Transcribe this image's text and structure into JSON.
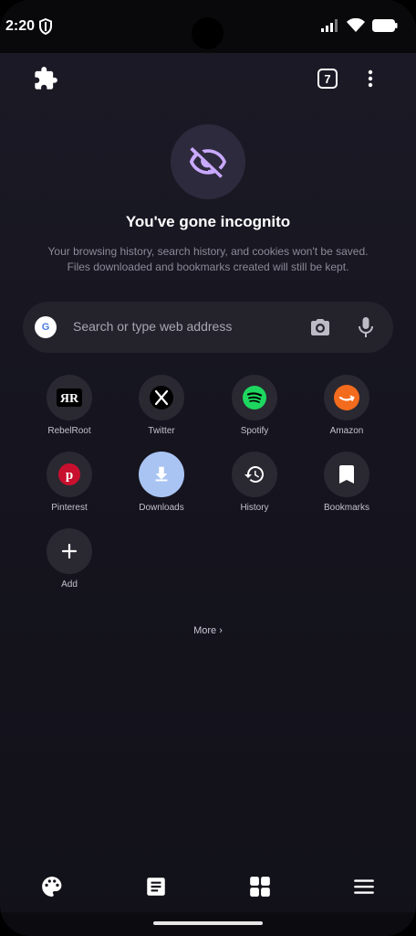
{
  "status_bar": {
    "time": "2:20"
  },
  "toolbar": {
    "tab_count": "7"
  },
  "incognito": {
    "title": "You've gone incognito",
    "description_line1": "Your browsing history, search history, and cookies won't be saved.",
    "description_line2": "Files downloaded and bookmarks created will still be kept."
  },
  "search": {
    "placeholder": "Search or type web address",
    "engine_letter": "G"
  },
  "shortcuts": [
    {
      "label": "RebelRoot",
      "icon": "rebelroot-icon"
    },
    {
      "label": "Twitter",
      "icon": "x-logo-icon"
    },
    {
      "label": "Spotify",
      "icon": "spotify-icon"
    },
    {
      "label": "Amazon",
      "icon": "amazon-icon"
    },
    {
      "label": "Pinterest",
      "icon": "pinterest-icon"
    },
    {
      "label": "Downloads",
      "icon": "download-icon"
    },
    {
      "label": "History",
      "icon": "history-icon"
    },
    {
      "label": "Bookmarks",
      "icon": "bookmark-icon"
    },
    {
      "label": "Add",
      "icon": "plus-icon"
    }
  ],
  "more_label": "More ›",
  "colors": {
    "accent_purple": "#c9a9ff",
    "downloads_active": "#a9c4f3",
    "spotify_green": "#1ed760",
    "amazon_orange": "#f36b1c",
    "pinterest_red": "#c8102e"
  }
}
